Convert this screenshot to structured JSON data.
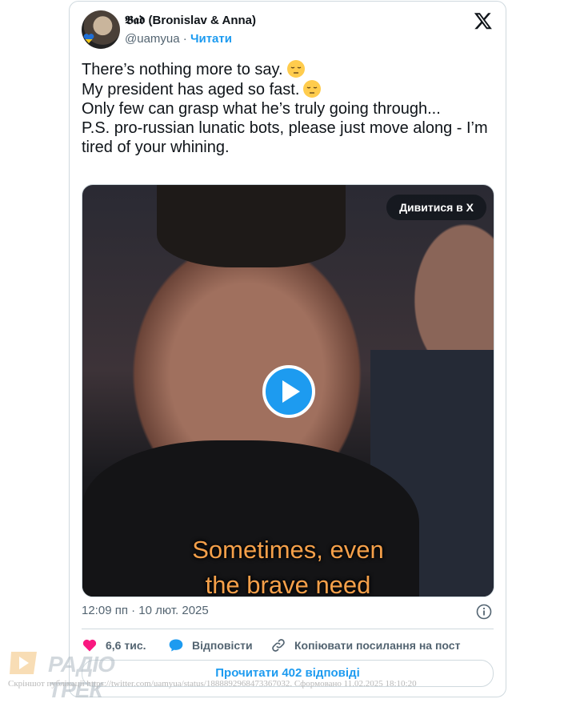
{
  "tweet": {
    "display_name": "𝕭𝖆𝖉 (Bronislav & Anna)",
    "handle": "@uamyua",
    "separator": "·",
    "follow_label": "Читати",
    "text_lines": [
      "There’s nothing more to say.",
      "My president has aged so fast.",
      "Only few can grasp what he’s truly going through...",
      "",
      "P.S. pro-russian lunatic bots, please just move along - I’m tired of your whining."
    ],
    "emoji": "pensive-face",
    "time": "12:09 пп",
    "date": "10 лют. 2025"
  },
  "media": {
    "watch_label": "Дивитися в X",
    "caption_line1": "Sometimes, even",
    "caption_line2": "the brave need"
  },
  "actions": {
    "likes": "6,6 тис.",
    "reply_label": "Відповісти",
    "copy_link_label": "Копіювати посилання на пост",
    "read_replies_label": "Прочитати 402 відповіді"
  },
  "watermark": {
    "brand": "РАДІО ТРЕК",
    "footer": "Скріншот публікації https://twitter.com/uamyua/status/1888892968473367032. Сформовано 11.02.2025 18:10:20"
  },
  "colors": {
    "accent": "#1d9bf0",
    "like": "#f91880",
    "muted": "#536471",
    "caption": "#f5a04a"
  }
}
